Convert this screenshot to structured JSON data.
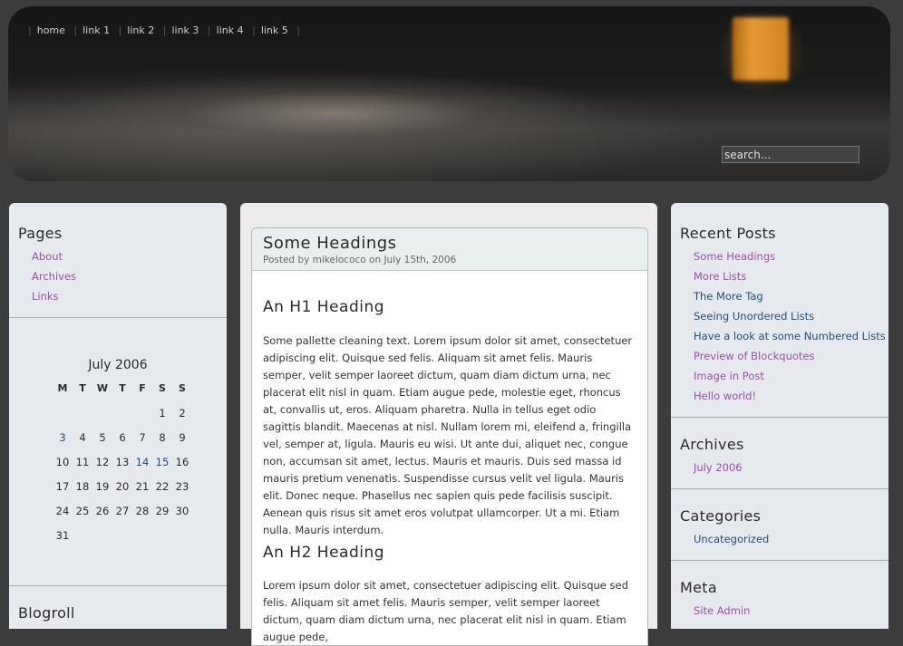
{
  "nav": [
    "home",
    "link 1",
    "link 2",
    "link 3",
    "link 4",
    "link 5"
  ],
  "search": {
    "placeholder": "search..."
  },
  "sidebar_left": {
    "pages_title": "Pages",
    "pages": [
      "About",
      "Archives",
      "Links"
    ],
    "calendar": {
      "caption": "July 2006",
      "days": [
        "M",
        "T",
        "W",
        "T",
        "F",
        "S",
        "S"
      ],
      "rows": [
        [
          "",
          "",
          "",
          "",
          "",
          "1",
          "2"
        ],
        [
          "3",
          "4",
          "5",
          "6",
          "7",
          "8",
          "9"
        ],
        [
          "10",
          "11",
          "12",
          "13",
          "14",
          "15",
          "16"
        ],
        [
          "17",
          "18",
          "19",
          "20",
          "21",
          "22",
          "23"
        ],
        [
          "24",
          "25",
          "26",
          "27",
          "28",
          "29",
          "30"
        ],
        [
          "31",
          "",
          "",
          "",
          "",
          "",
          ""
        ]
      ],
      "linked_days": [
        "3",
        "14",
        "15"
      ]
    },
    "blogroll_title": "Blogroll"
  },
  "post": {
    "title": "Some Headings",
    "meta": "Posted by mikelococo on July 15th, 2006",
    "h1": "An H1 Heading",
    "p1": "Some pallette cleaning text.  Lorem ipsum dolor sit amet, consectetuer adipiscing elit. Quisque sed felis. Aliquam sit amet felis. Mauris semper, velit semper laoreet dictum, quam diam dictum urna, nec placerat elit nisl in quam. Etiam augue pede, molestie eget, rhoncus at, convallis ut, eros. Aliquam pharetra. Nulla in tellus eget odio sagittis blandit. Maecenas at nisl. Nullam lorem mi, eleifend a, fringilla vel, semper at, ligula. Mauris eu wisi. Ut ante dui, aliquet nec, congue non, accumsan sit amet, lectus. Mauris et mauris. Duis sed massa id mauris pretium venenatis. Suspendisse cursus velit vel ligula. Mauris elit. Donec neque. Phasellus nec sapien quis pede facilisis suscipit. Aenean quis risus sit amet eros volutpat ullamcorper. Ut a mi. Etiam nulla. Mauris interdum.",
    "h2": "An H2 Heading",
    "p2": "Lorem ipsum dolor sit amet, consectetuer adipiscing elit. Quisque sed felis. Aliquam sit amet felis. Mauris semper, velit semper laoreet dictum, quam diam dictum urna, nec placerat elit nisl in quam. Etiam augue pede,"
  },
  "sidebar_right": {
    "recent_title": "Recent Posts",
    "recent": [
      {
        "label": "Some Headings",
        "color": "#9a4fa8"
      },
      {
        "label": "More Lists",
        "color": "#9a4fa8"
      },
      {
        "label": "The More Tag",
        "color": "#1d4f7a"
      },
      {
        "label": "Seeing Unordered Lists",
        "color": "#1d4f7a"
      },
      {
        "label": "Have a look at some Numbered Lists",
        "color": "#1d4f7a"
      },
      {
        "label": "Preview of Blockquotes",
        "color": "#9a4fa8"
      },
      {
        "label": "Image in Post",
        "color": "#9a4fa8"
      },
      {
        "label": "Hello world!",
        "color": "#9a4fa8"
      }
    ],
    "archives_title": "Archives",
    "archives": [
      "July 2006"
    ],
    "categories_title": "Categories",
    "categories": [
      "Uncategorized"
    ],
    "meta_title": "Meta",
    "meta": [
      "Site Admin"
    ]
  }
}
